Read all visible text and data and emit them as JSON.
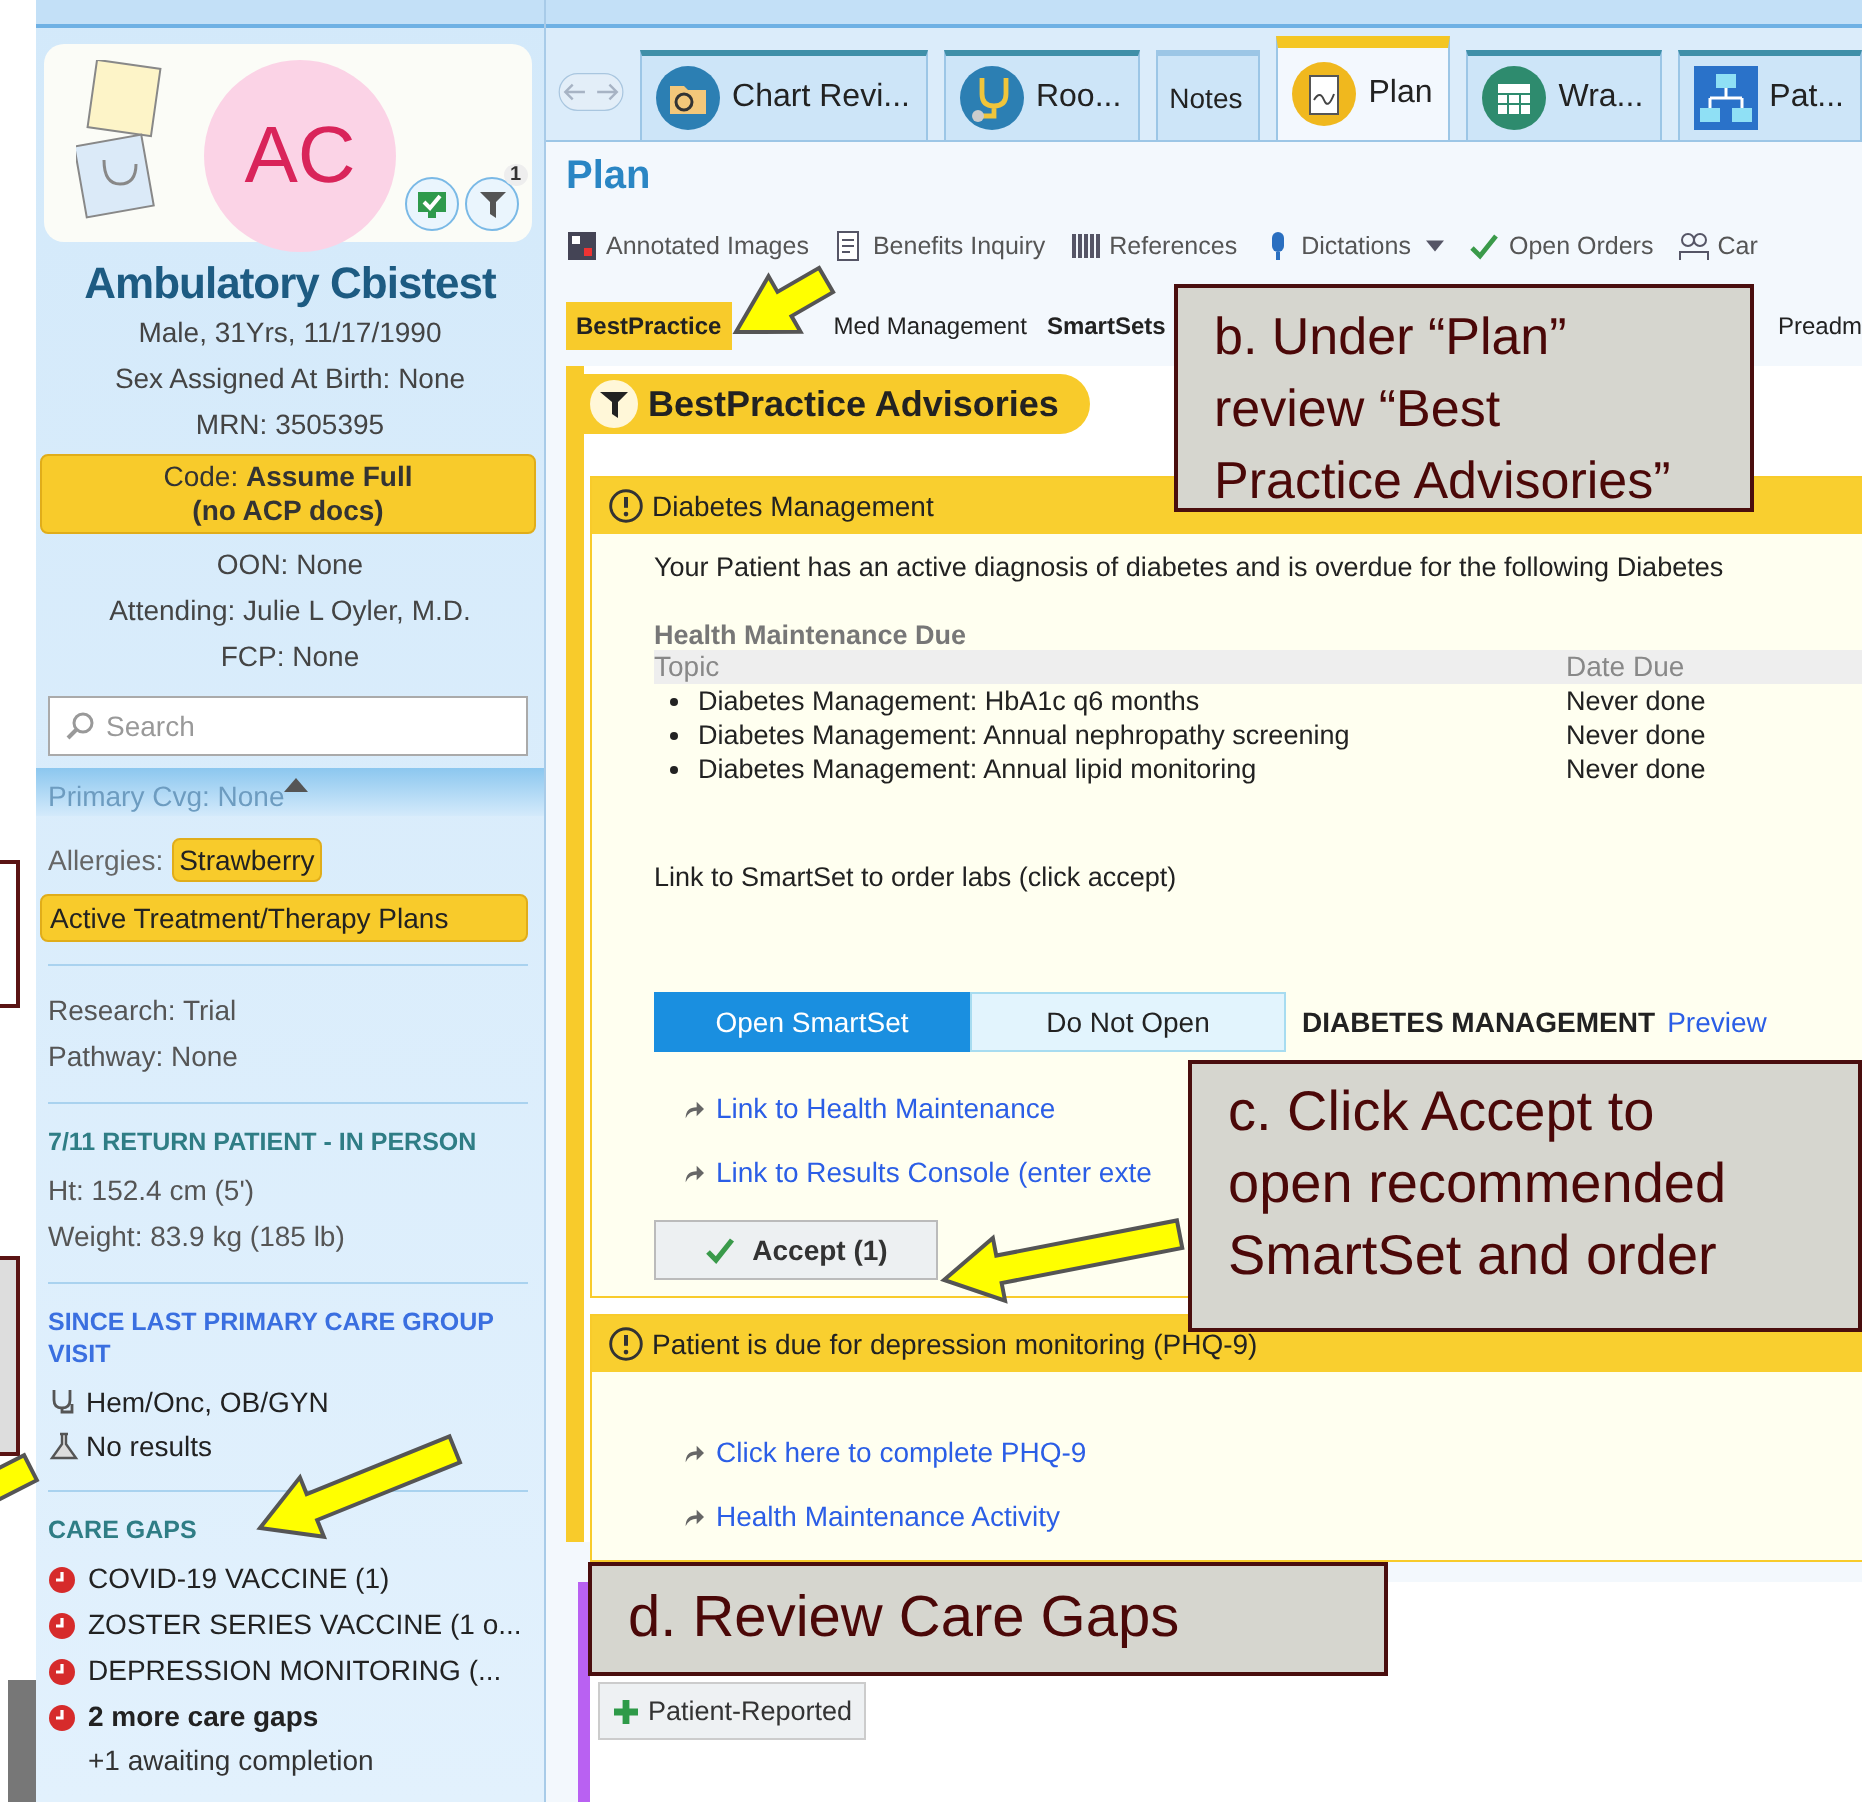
{
  "patient": {
    "initials": "AC",
    "badge_count": "1",
    "name": "Ambulatory Cbistest",
    "lines": [
      "Male, 31Yrs, 11/17/1990",
      "Sex Assigned At Birth: None",
      "MRN: 3505395"
    ],
    "code_lines": [
      "Code: **Assume Full**",
      "**(no ACP docs)**"
    ],
    "more_lines": [
      "OON: None",
      "Attending: Julie L Oyler, M.D.",
      "FCP: None"
    ],
    "search": {
      "placeholder": "Search"
    },
    "coverage": "Primary Cvg: None",
    "allergies": {
      "label": "Allergies:",
      "value": "Strawberry"
    },
    "flag": "Active Treatment/Therapy Plans",
    "research": [
      "Research: Trial",
      "Pathway: None"
    ],
    "encounter": {
      "title": "7/11 RETURN PATIENT - IN PERSON",
      "vitals": [
        "Ht:  152.4 cm (5')",
        "Weight:  83.9 kg (185 lb)"
      ]
    },
    "since_last": {
      "title": "SINCE LAST PRIMARY CARE GROUP VISIT",
      "items": [
        {
          "kind": "specialty",
          "text": "Hem/Onc, OB/GYN"
        },
        {
          "kind": "results",
          "text": "No results"
        }
      ]
    },
    "care_gaps": {
      "title": "CARE GAPS",
      "items": [
        {
          "text": "COVID-19 VACCINE (1)",
          "bold": false
        },
        {
          "text": "ZOSTER SERIES VACCINE (1 o...",
          "bold": false
        },
        {
          "text": "DEPRESSION MONITORING (...",
          "bold": false
        },
        {
          "text": "2 more care gaps",
          "bold": true
        }
      ],
      "note": "+1 awaiting completion"
    }
  },
  "activity_tabs": [
    {
      "label": "Chart Revi...",
      "selected": false
    },
    {
      "label": "Roo...",
      "selected": false
    },
    {
      "label": "Notes",
      "selected": false
    },
    {
      "label": "Plan",
      "selected": true
    },
    {
      "label": "Wra...",
      "selected": false
    },
    {
      "label": "Pat...",
      "selected": false
    }
  ],
  "plan_title": "Plan",
  "toolbar": [
    {
      "label": "Annotated Images",
      "menu": false
    },
    {
      "label": "Benefits Inquiry",
      "menu": false
    },
    {
      "label": "References",
      "menu": false
    },
    {
      "label": "Dictations",
      "menu": true
    },
    {
      "label": "Open Orders",
      "menu": false
    },
    {
      "label": "Car",
      "menu": false
    }
  ],
  "sub_tabs": [
    {
      "label": "BestPractice",
      "selected": true,
      "emphasized": true
    },
    {
      "label": "Med Management",
      "selected": false,
      "emphasized": false
    },
    {
      "label": "SmartSets",
      "selected": false,
      "emphasized": true
    },
    {
      "label": "Preadm",
      "selected": false,
      "emphasized": false
    }
  ],
  "advisories": {
    "title": "BestPractice Advisories",
    "items": [
      {
        "header": "Diabetes Management",
        "intro": "Your Patient has an active diagnosis of diabetes and is overdue for the following Diabetes",
        "table": {
          "title": "Health Maintenance Due",
          "columns": [
            "Topic",
            "Date Due"
          ],
          "rows": [
            {
              "topic": "Diabetes Management: HbA1c q6 months",
              "date_due": "Never done"
            },
            {
              "topic": "Diabetes Management: Annual nephropathy screening",
              "date_due": "Never done"
            },
            {
              "topic": "Diabetes Management: Annual lipid monitoring",
              "date_due": "Never done"
            }
          ]
        },
        "note": "Link to SmartSet to order labs (click accept)",
        "choices": [
          {
            "label": "Open SmartSet",
            "selected": true
          },
          {
            "label": "Do Not Open",
            "selected": false
          }
        ],
        "smartset": "DIABETES MANAGEMENT",
        "preview": "Preview",
        "links": [
          "Link to Health Maintenance",
          "Link to Results Console (enter exte"
        ],
        "accept": "Accept (1)"
      },
      {
        "header": "Patient is due for depression monitoring (PHQ-9)",
        "links": [
          "Click here to complete PHQ-9",
          "Health Maintenance Activity"
        ]
      }
    ]
  },
  "patient_reported": "Patient-Reported",
  "callouts": [
    "b. Under “Plan” review “Best Practice Advisories”",
    "c. Click Accept to open recommended SmartSet and order",
    "d. Review Care Gaps"
  ]
}
